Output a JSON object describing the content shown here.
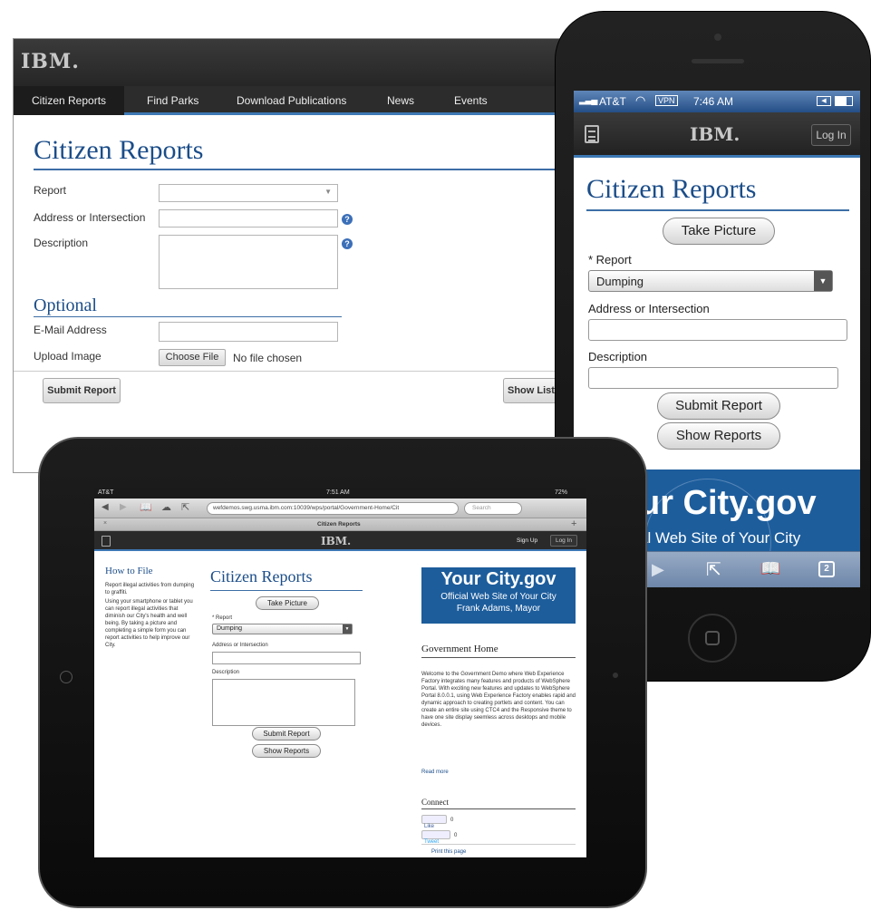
{
  "desktop": {
    "logo": "IBM.",
    "nav": [
      "Citizen Reports",
      "Find Parks",
      "Download Publications",
      "News",
      "Events"
    ],
    "title": "Citizen Reports",
    "fields": {
      "report_label": "Report",
      "address_label": "Address or Intersection",
      "description_label": "Description",
      "optional_heading": "Optional",
      "email_label": "E-Mail Address",
      "upload_label": "Upload Image",
      "choose_file": "Choose File",
      "no_file": "No file chosen",
      "help": "?"
    },
    "submit": "Submit Report",
    "show_list": "Show List"
  },
  "phone": {
    "carrier": "AT&T",
    "network": "VPN",
    "time": "7:46 AM",
    "logo": "IBM.",
    "login": "Log In",
    "title": "Citizen Reports",
    "take_picture": "Take Picture",
    "report_label": "* Report",
    "report_value": "Dumping",
    "address_label": "Address or Intersection",
    "description_label": "Description",
    "submit": "Submit Report",
    "show_reports": "Show Reports",
    "banner_title": "ur City.gov",
    "banner_sub": "al Web Site of Your City",
    "tabs_count": "2"
  },
  "tablet": {
    "carrier": "AT&T",
    "time": "7:51 AM",
    "battery": "72%",
    "url": "wefdemos.swg.usma.ibm.com:10039/wps/portal/Government-Home/Cit",
    "search_placeholder": "Search",
    "tab_title": "Citizen Reports",
    "logo": "IBM.",
    "sign_up": "Sign Up",
    "login": "Log In",
    "how_title": "How to File",
    "how_text1": "Report illegal activities from dumping to graffiti.",
    "how_text2": "Using your smartphone or tablet you can report illegal activities that diminish our City's health and well being. By taking a picture and completing a simple form you can report activities to help improve our City.",
    "title": "Citizen Reports",
    "take_picture": "Take Picture",
    "report_label": "* Report",
    "report_value": "Dumping",
    "address_label": "Address or Intersection",
    "description_label": "Description",
    "submit": "Submit Report",
    "show_reports": "Show Reports",
    "banner_title": "Your City.gov",
    "banner_sub": "Official Web Site of Your City",
    "banner_mayor": "Frank Adams, Mayor",
    "gov_title": "Government Home",
    "gov_text": "Welcome to the Government Demo where Web Experience Factory integrates many features and products of WebSphere Portal. With exciting new features and updates to WebSphere Portal 8.0.0.1, using Web Experience Factory enables rapid and dynamic approach to creating portlets and content. You can create an entire site using CTC4 and the Responsive theme to have one site display seemless across desktops and mobile devices.",
    "read_more": "Read more",
    "connect": "Connect",
    "like": "Like",
    "tweet": "Tweet",
    "count": "0",
    "print": "Print this page"
  }
}
